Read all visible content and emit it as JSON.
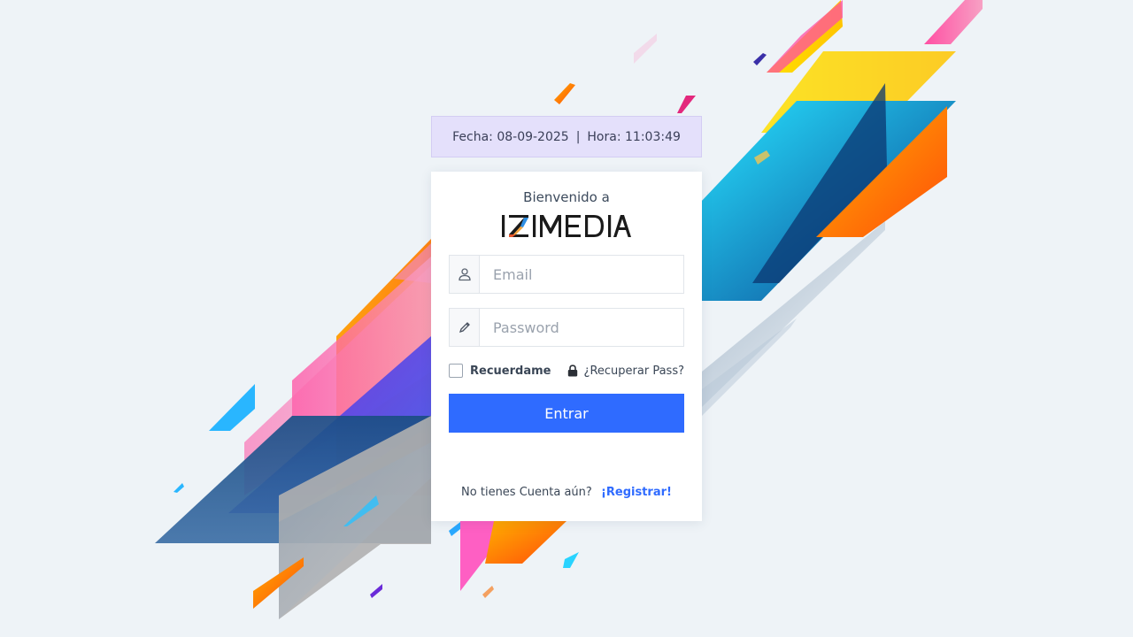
{
  "header": {
    "date_label": "Fecha: 08-09-2025",
    "separator": "|",
    "time_label": "Hora: 11:03:49"
  },
  "login": {
    "welcome": "Bienvenido a",
    "brand": "IZIMEDIA",
    "email_placeholder": "Email",
    "password_placeholder": "Password",
    "remember_label": "Recuerdame",
    "recover_label": "¿Recuperar Pass?",
    "submit_label": "Entrar",
    "signup_prompt": "No tienes Cuenta aún?",
    "signup_link": "¡Registrar!"
  },
  "icons": {
    "email": "user-icon",
    "password": "pencil-icon",
    "recover": "lock-icon"
  },
  "colors": {
    "accent": "#2f6bff",
    "date_bar_bg": "#e4e0fb",
    "page_bg": "#eef3f7"
  }
}
